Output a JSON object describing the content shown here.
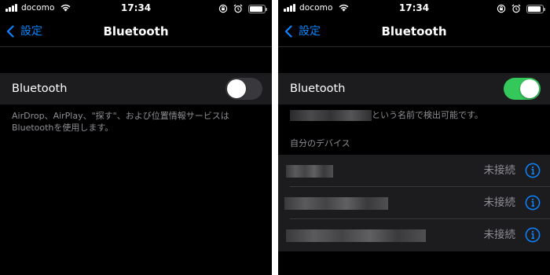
{
  "colors": {
    "accent": "#0a84ff",
    "toggle_on": "#34c759",
    "toggle_off": "#39393d",
    "background": "#000000",
    "cell": "#1c1c1e",
    "secondary_text": "#8e8e93"
  },
  "left_screen": {
    "status": {
      "carrier": "docomo",
      "time": "17:34",
      "icons": [
        "signal-icon",
        "wifi-icon",
        "orientation-lock-icon",
        "alarm-icon",
        "battery-icon"
      ]
    },
    "nav": {
      "back_label": "設定",
      "title": "Bluetooth"
    },
    "bluetooth": {
      "label": "Bluetooth",
      "enabled": false
    },
    "footnote": "AirDrop、AirPlay、\"探す\"、および位置情報サービスはBluetoothを使用します。"
  },
  "right_screen": {
    "status": {
      "carrier": "docomo",
      "time": "17:34",
      "icons": [
        "signal-icon",
        "wifi-icon",
        "orientation-lock-icon",
        "alarm-icon",
        "battery-icon"
      ]
    },
    "nav": {
      "back_label": "設定",
      "title": "Bluetooth"
    },
    "bluetooth": {
      "label": "Bluetooth",
      "enabled": true
    },
    "discoverable_text": "という名前で検出可能です。",
    "my_devices_header": "自分のデバイス",
    "devices": [
      {
        "status": "未接続"
      },
      {
        "status": "未接続"
      },
      {
        "status": "未接続"
      }
    ]
  }
}
